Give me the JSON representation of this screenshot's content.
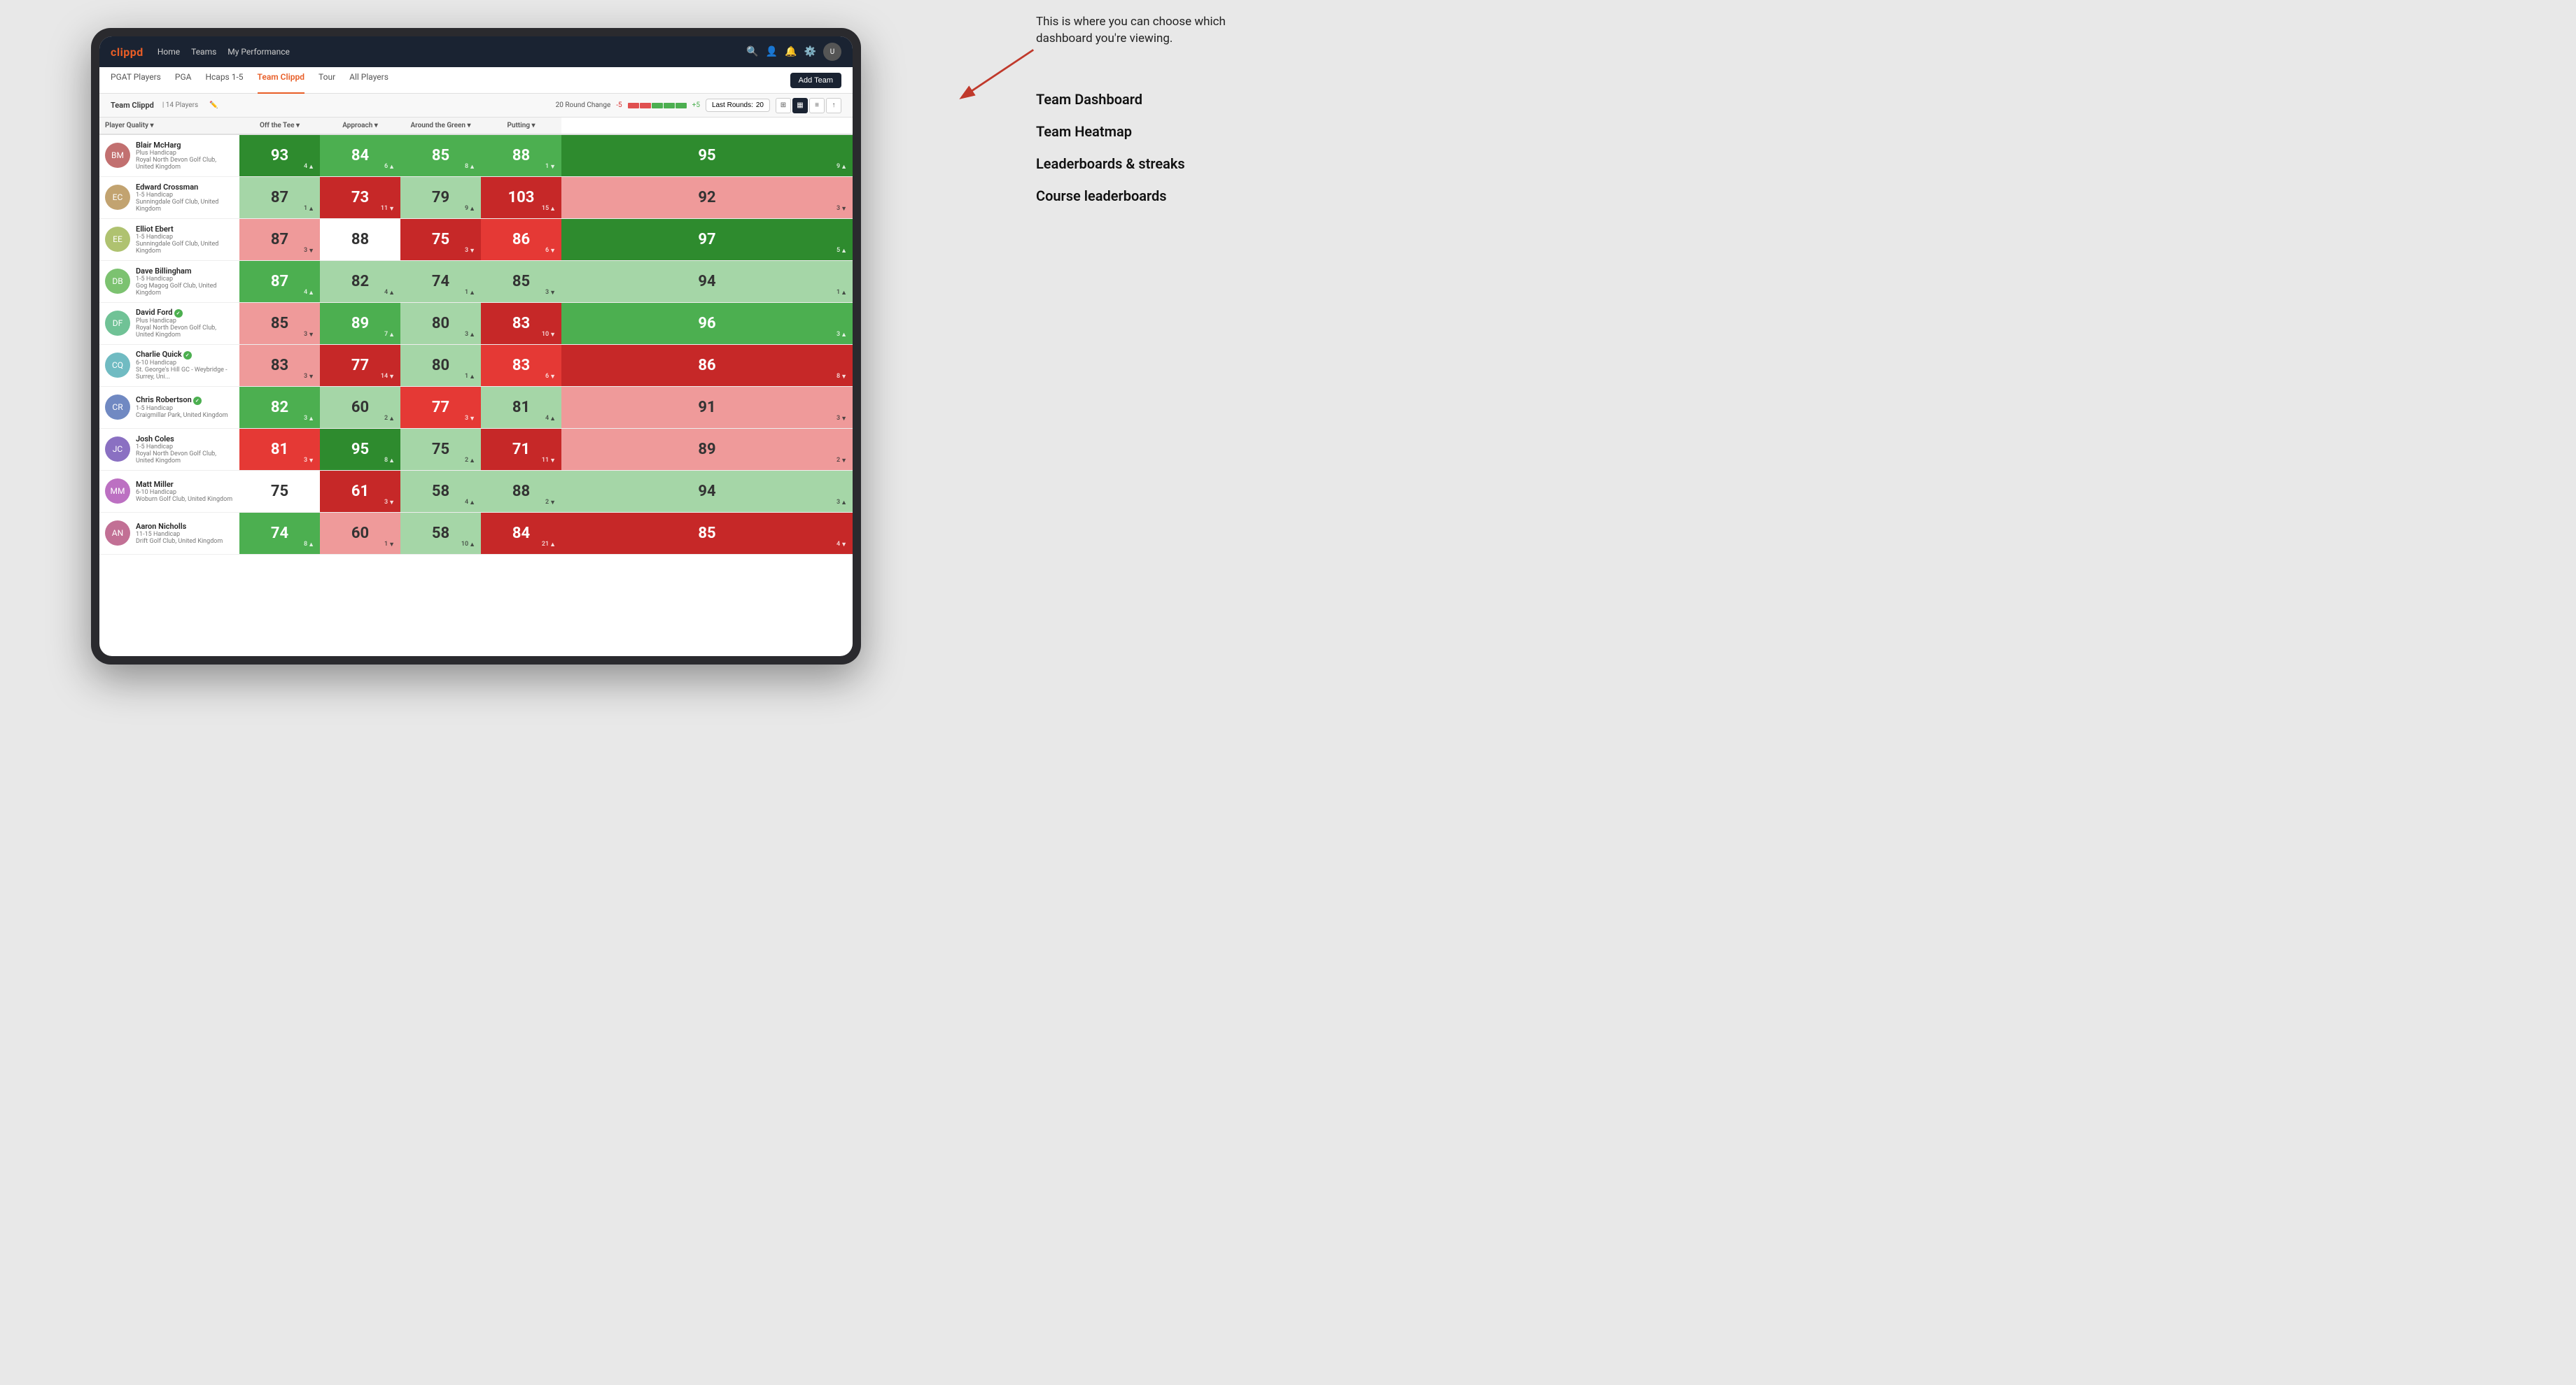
{
  "annotation": {
    "intro_text": "This is where you can choose which dashboard you're viewing.",
    "options": [
      "Team Dashboard",
      "Team Heatmap",
      "Leaderboards & streaks",
      "Course leaderboards"
    ]
  },
  "nav": {
    "logo": "clippd",
    "items": [
      "Home",
      "Teams",
      "My Performance"
    ],
    "active": "Teams"
  },
  "tabs": {
    "items": [
      "PGAT Players",
      "PGA",
      "Hcaps 1-5",
      "Team Clippd",
      "Tour",
      "All Players"
    ],
    "active": "Team Clippd",
    "add_button": "Add Team"
  },
  "team_header": {
    "name": "Team Clippd",
    "separator": "|",
    "count": "14 Players",
    "round_change_label": "20 Round Change",
    "neg_label": "-5",
    "pos_label": "+5",
    "last_rounds_label": "Last Rounds:",
    "last_rounds_value": "20"
  },
  "table": {
    "columns": [
      "Player Quality ▾",
      "Off the Tee ▾",
      "Approach ▾",
      "Around the Green ▾",
      "Putting ▾"
    ],
    "players": [
      {
        "name": "Blair McHarg",
        "hcap": "Plus Handicap",
        "club": "Royal North Devon Golf Club, United Kingdom",
        "scores": [
          {
            "value": 93,
            "change": 4,
            "dir": "up",
            "color": "green-dark"
          },
          {
            "value": 84,
            "change": 6,
            "dir": "up",
            "color": "green-mid"
          },
          {
            "value": 85,
            "change": 8,
            "dir": "up",
            "color": "green-mid"
          },
          {
            "value": 88,
            "change": 1,
            "dir": "down",
            "color": "green-mid"
          },
          {
            "value": 95,
            "change": 9,
            "dir": "up",
            "color": "green-dark"
          }
        ]
      },
      {
        "name": "Edward Crossman",
        "hcap": "1-5 Handicap",
        "club": "Sunningdale Golf Club, United Kingdom",
        "scores": [
          {
            "value": 87,
            "change": 1,
            "dir": "up",
            "color": "green-light"
          },
          {
            "value": 73,
            "change": 11,
            "dir": "down",
            "color": "red-dark"
          },
          {
            "value": 79,
            "change": 9,
            "dir": "up",
            "color": "green-light"
          },
          {
            "value": 103,
            "change": 15,
            "dir": "up",
            "color": "red-dark"
          },
          {
            "value": 92,
            "change": 3,
            "dir": "down",
            "color": "red-light"
          }
        ]
      },
      {
        "name": "Elliot Ebert",
        "hcap": "1-5 Handicap",
        "club": "Sunningdale Golf Club, United Kingdom",
        "scores": [
          {
            "value": 87,
            "change": 3,
            "dir": "down",
            "color": "red-light"
          },
          {
            "value": 88,
            "change": null,
            "dir": null,
            "color": "neutral"
          },
          {
            "value": 75,
            "change": 3,
            "dir": "down",
            "color": "red-dark"
          },
          {
            "value": 86,
            "change": 6,
            "dir": "down",
            "color": "red-mid"
          },
          {
            "value": 97,
            "change": 5,
            "dir": "up",
            "color": "green-dark"
          }
        ]
      },
      {
        "name": "Dave Billingham",
        "hcap": "1-5 Handicap",
        "club": "Gog Magog Golf Club, United Kingdom",
        "scores": [
          {
            "value": 87,
            "change": 4,
            "dir": "up",
            "color": "green-mid"
          },
          {
            "value": 82,
            "change": 4,
            "dir": "up",
            "color": "green-light"
          },
          {
            "value": 74,
            "change": 1,
            "dir": "up",
            "color": "green-light"
          },
          {
            "value": 85,
            "change": 3,
            "dir": "down",
            "color": "green-light"
          },
          {
            "value": 94,
            "change": 1,
            "dir": "up",
            "color": "green-light"
          }
        ]
      },
      {
        "name": "David Ford",
        "hcap": "Plus Handicap",
        "club": "Royal North Devon Golf Club, United Kingdom",
        "verified": true,
        "scores": [
          {
            "value": 85,
            "change": 3,
            "dir": "down",
            "color": "red-light"
          },
          {
            "value": 89,
            "change": 7,
            "dir": "up",
            "color": "green-mid"
          },
          {
            "value": 80,
            "change": 3,
            "dir": "up",
            "color": "green-light"
          },
          {
            "value": 83,
            "change": 10,
            "dir": "down",
            "color": "red-dark"
          },
          {
            "value": 96,
            "change": 3,
            "dir": "up",
            "color": "green-mid"
          }
        ]
      },
      {
        "name": "Charlie Quick",
        "hcap": "6-10 Handicap",
        "club": "St. George's Hill GC - Weybridge - Surrey, Uni...",
        "verified": true,
        "scores": [
          {
            "value": 83,
            "change": 3,
            "dir": "down",
            "color": "red-light"
          },
          {
            "value": 77,
            "change": 14,
            "dir": "down",
            "color": "red-dark"
          },
          {
            "value": 80,
            "change": 1,
            "dir": "up",
            "color": "green-light"
          },
          {
            "value": 83,
            "change": 6,
            "dir": "down",
            "color": "red-mid"
          },
          {
            "value": 86,
            "change": 8,
            "dir": "down",
            "color": "red-dark"
          }
        ]
      },
      {
        "name": "Chris Robertson",
        "hcap": "1-5 Handicap",
        "club": "Craigmillar Park, United Kingdom",
        "verified": true,
        "scores": [
          {
            "value": 82,
            "change": 3,
            "dir": "up",
            "color": "green-mid"
          },
          {
            "value": 60,
            "change": 2,
            "dir": "up",
            "color": "green-light"
          },
          {
            "value": 77,
            "change": 3,
            "dir": "down",
            "color": "red-mid"
          },
          {
            "value": 81,
            "change": 4,
            "dir": "up",
            "color": "green-light"
          },
          {
            "value": 91,
            "change": 3,
            "dir": "down",
            "color": "red-light"
          }
        ]
      },
      {
        "name": "Josh Coles",
        "hcap": "1-5 Handicap",
        "club": "Royal North Devon Golf Club, United Kingdom",
        "scores": [
          {
            "value": 81,
            "change": 3,
            "dir": "down",
            "color": "red-mid"
          },
          {
            "value": 95,
            "change": 8,
            "dir": "up",
            "color": "green-dark"
          },
          {
            "value": 75,
            "change": 2,
            "dir": "up",
            "color": "green-light"
          },
          {
            "value": 71,
            "change": 11,
            "dir": "down",
            "color": "red-dark"
          },
          {
            "value": 89,
            "change": 2,
            "dir": "down",
            "color": "red-light"
          }
        ]
      },
      {
        "name": "Matt Miller",
        "hcap": "6-10 Handicap",
        "club": "Woburn Golf Club, United Kingdom",
        "scores": [
          {
            "value": 75,
            "change": null,
            "dir": null,
            "color": "neutral"
          },
          {
            "value": 61,
            "change": 3,
            "dir": "down",
            "color": "red-dark"
          },
          {
            "value": 58,
            "change": 4,
            "dir": "up",
            "color": "green-light"
          },
          {
            "value": 88,
            "change": 2,
            "dir": "down",
            "color": "green-light"
          },
          {
            "value": 94,
            "change": 3,
            "dir": "up",
            "color": "green-light"
          }
        ]
      },
      {
        "name": "Aaron Nicholls",
        "hcap": "11-15 Handicap",
        "club": "Drift Golf Club, United Kingdom",
        "scores": [
          {
            "value": 74,
            "change": 8,
            "dir": "up",
            "color": "green-mid"
          },
          {
            "value": 60,
            "change": 1,
            "dir": "down",
            "color": "red-light"
          },
          {
            "value": 58,
            "change": 10,
            "dir": "up",
            "color": "green-light"
          },
          {
            "value": 84,
            "change": 21,
            "dir": "up",
            "color": "red-dark"
          },
          {
            "value": 85,
            "change": 4,
            "dir": "down",
            "color": "red-dark"
          }
        ]
      }
    ]
  }
}
